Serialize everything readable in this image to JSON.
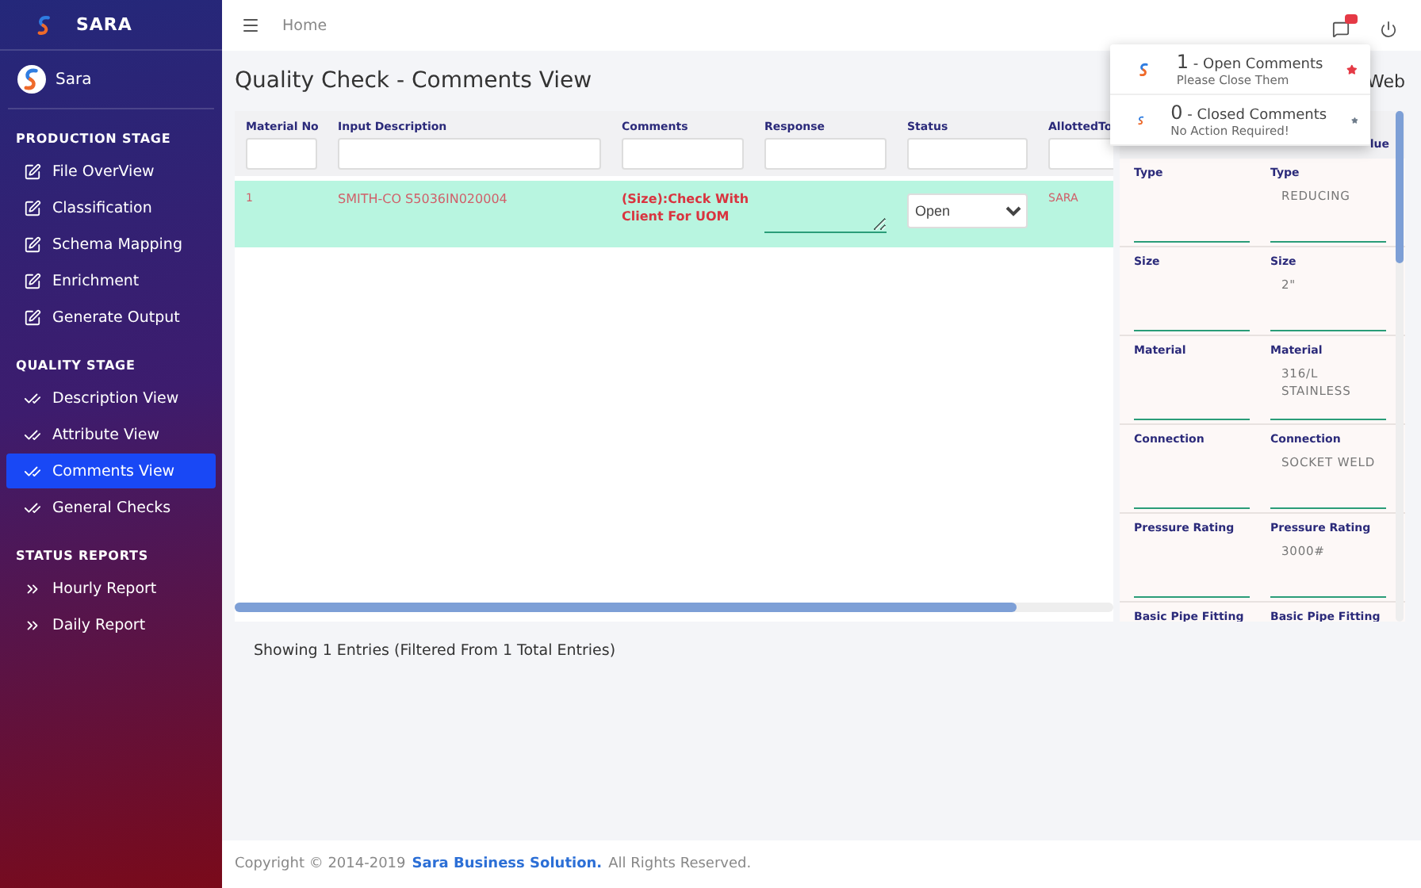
{
  "brand": {
    "name": "SARA"
  },
  "user": {
    "name": "Sara"
  },
  "sidebar": {
    "sections": [
      {
        "title": "PRODUCTION STAGE",
        "items": [
          {
            "label": "File OverView",
            "kind": "edit",
            "selected": false
          },
          {
            "label": "Classification",
            "kind": "edit",
            "selected": false
          },
          {
            "label": "Schema Mapping",
            "kind": "edit",
            "selected": false
          },
          {
            "label": "Enrichment",
            "kind": "edit",
            "selected": false
          },
          {
            "label": "Generate Output",
            "kind": "edit",
            "selected": false
          }
        ]
      },
      {
        "title": "QUALITY STAGE",
        "items": [
          {
            "label": "Description View",
            "kind": "check",
            "selected": false
          },
          {
            "label": "Attribute View",
            "kind": "check",
            "selected": false
          },
          {
            "label": "Comments View",
            "kind": "check",
            "selected": true
          },
          {
            "label": "General Checks",
            "kind": "check",
            "selected": false
          }
        ]
      },
      {
        "title": "STATUS REPORTS",
        "items": [
          {
            "label": "Hourly Report",
            "kind": "report",
            "selected": false
          },
          {
            "label": "Daily Report",
            "kind": "report",
            "selected": false
          }
        ]
      }
    ]
  },
  "topbar": {
    "breadcrumb": "Home"
  },
  "page": {
    "title": "Quality Check - Comments View",
    "title_right": "Web"
  },
  "table": {
    "columns": [
      "Material No",
      "Input Description",
      "Comments",
      "Response",
      "Status",
      "AllottedTo"
    ],
    "rows": [
      {
        "material_no": "1",
        "input_description": "SMITH-CO S5036IN020004",
        "comments": "(Size):Check With Client For UOM",
        "response": "",
        "status": "Open",
        "allotted_to": "SARA"
      }
    ]
  },
  "attributes": {
    "header_right": "lue",
    "rows": [
      {
        "kind": "field",
        "left_label": "Type",
        "right_label": "Type",
        "value": "REDUCING"
      },
      {
        "kind": "field",
        "left_label": "Size",
        "right_label": "Size",
        "value": "2\""
      },
      {
        "kind": "field",
        "left_label": "Material",
        "right_label": "Material",
        "value": "316/L STAINLESS"
      },
      {
        "kind": "field",
        "left_label": "Connection",
        "right_label": "Connection",
        "value": "SOCKET WELD"
      },
      {
        "kind": "field",
        "left_label": "Pressure Rating",
        "right_label": "Pressure Rating",
        "value": "3000#"
      },
      {
        "kind": "heading",
        "left_label": "Basic Pipe Fitting",
        "right_label": "Basic Pipe Fitting"
      }
    ]
  },
  "notifications": [
    {
      "count": "1",
      "title": "- Open Comments",
      "subtitle": "Please Close Them",
      "color": "#e53945"
    },
    {
      "count": "0",
      "title": "- Closed Comments",
      "subtitle": "No Action Required!",
      "color": "#6c7a89"
    }
  ],
  "summary": "Showing 1 Entries (Filtered From 1 Total Entries)",
  "footer": {
    "prefix": "Copyright © 2014-2019",
    "link": "Sara Business Solution.",
    "suffix": "All Rights Reserved."
  }
}
